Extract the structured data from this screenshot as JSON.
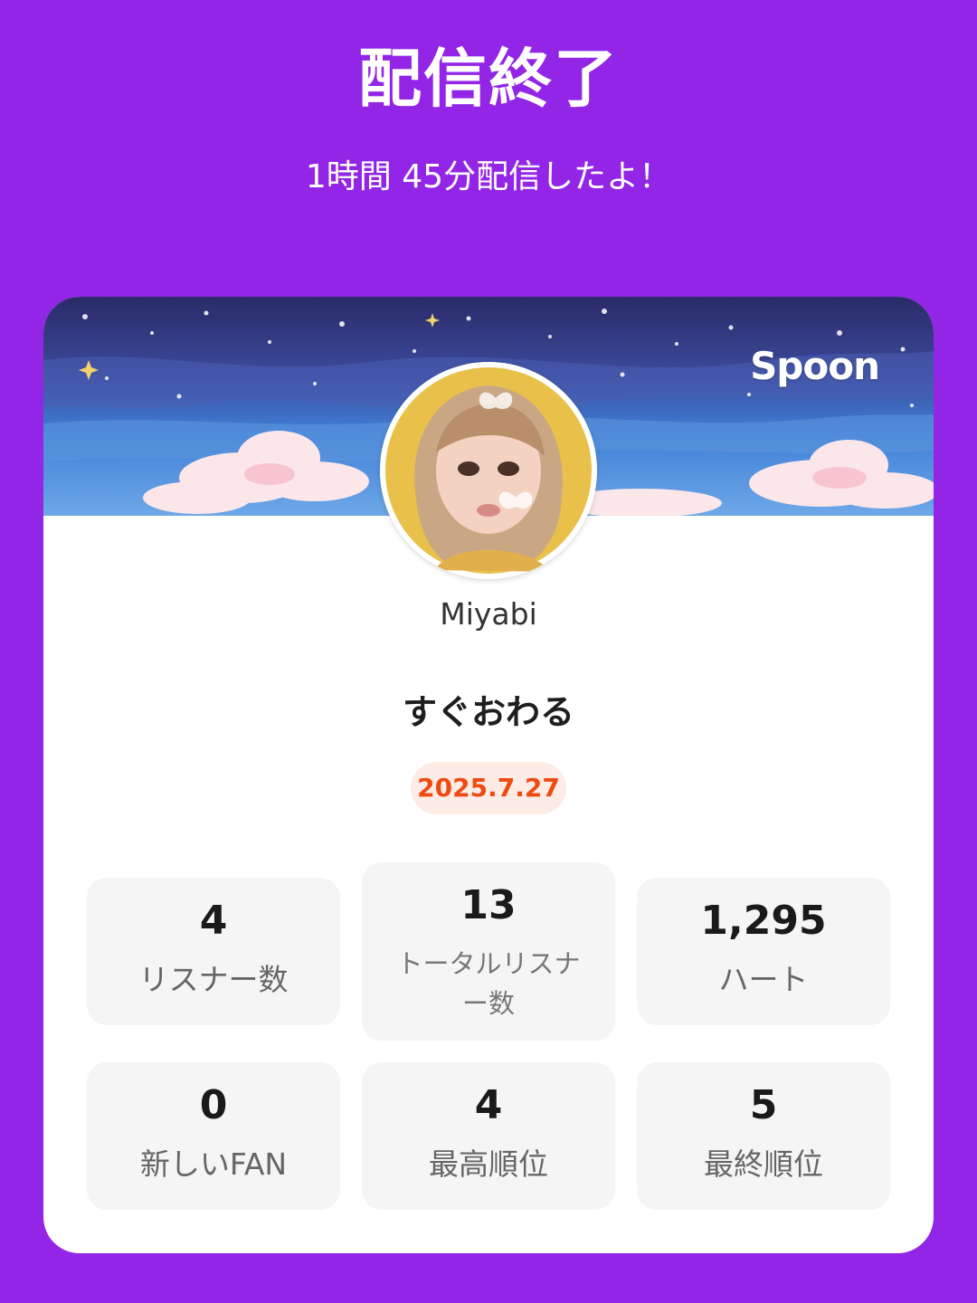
{
  "header": {
    "title": "配信終了",
    "subtitle": "1時間 45分配信したよ！"
  },
  "card": {
    "brand": "Spoon",
    "username": "Miyabi",
    "stream_title": "すぐおわる",
    "date": "2025.7.27",
    "stats": [
      {
        "value": "4",
        "label": "リスナー数"
      },
      {
        "value": "13",
        "label": "トータルリスナー数"
      },
      {
        "value": "1,295",
        "label": "ハート"
      },
      {
        "value": "0",
        "label": "新しいFAN"
      },
      {
        "value": "4",
        "label": "最高順位"
      },
      {
        "value": "5",
        "label": "最終順位"
      }
    ]
  },
  "colors": {
    "background": "#9225e6",
    "card": "#ffffff",
    "date_badge_bg": "#fdebe6",
    "date_badge_text": "#ee4a12",
    "stat_tile": "#f5f5f5"
  }
}
